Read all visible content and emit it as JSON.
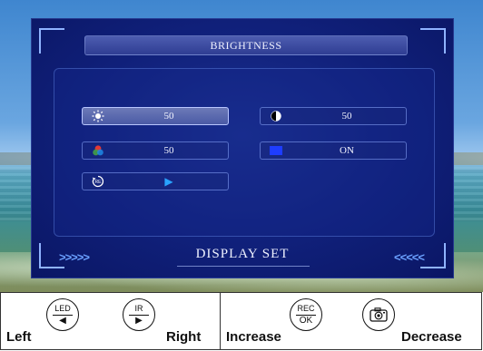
{
  "osd": {
    "header": "BRIGHTNESS",
    "footer": "DISPLAY SET",
    "left_arrows": ">>>>>",
    "right_arrows": "<<<<<",
    "items": [
      {
        "icon": "sun-brightness-icon",
        "value": "50",
        "active": true
      },
      {
        "icon": "contrast-icon",
        "value": "50",
        "active": false
      },
      {
        "icon": "color-saturation-icon",
        "value": "50",
        "active": false
      },
      {
        "icon": "blue-square-icon",
        "value": "ON",
        "active": false
      },
      {
        "icon": "reset-icon",
        "value": "▶",
        "active": false
      }
    ]
  },
  "legend": {
    "left_label": "Left",
    "right_label": "Right",
    "increase_label": "Increase",
    "decrease_label": "Decrease",
    "led_button": {
      "top": "LED",
      "bottom": "◀"
    },
    "ir_button": {
      "top": "IR",
      "bottom": "▶"
    },
    "rec_button": {
      "top": "REC",
      "bottom": "OK"
    },
    "camera_button": {
      "icon": "camera-icon"
    }
  },
  "colors": {
    "panel": "#10207a",
    "accent": "#6aa0ff",
    "active_item": "#5b69b0"
  }
}
